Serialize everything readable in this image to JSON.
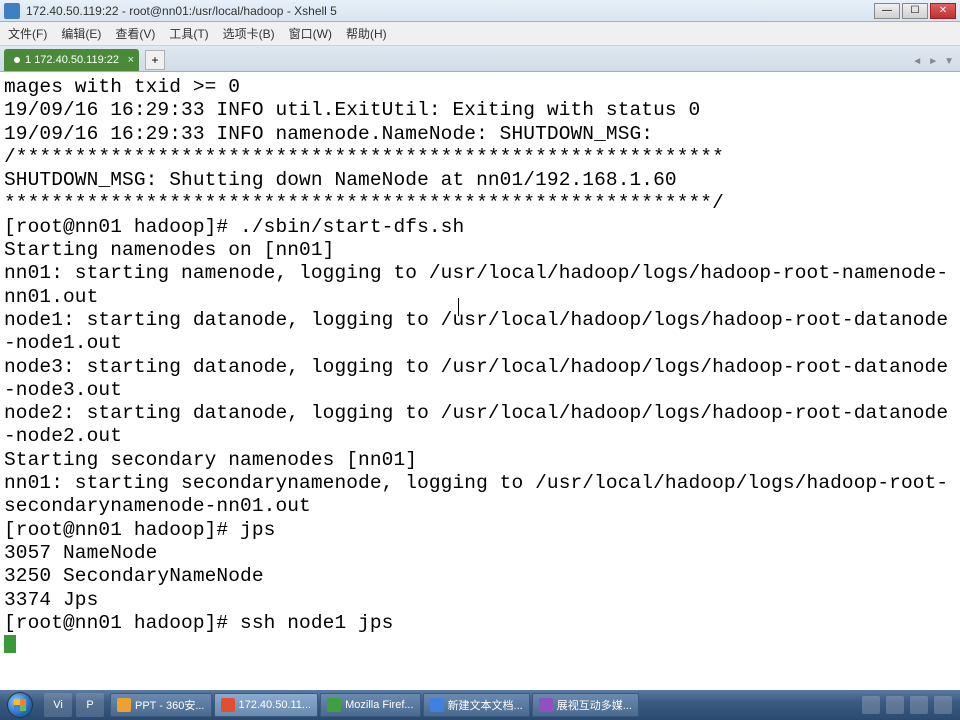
{
  "window": {
    "title": "172.40.50.119:22 - root@nn01:/usr/local/hadoop - Xshell 5"
  },
  "menu": {
    "file": "文件(F)",
    "edit": "编辑(E)",
    "view": "查看(V)",
    "tools": "工具(T)",
    "tabs": "选项卡(B)",
    "window": "窗口(W)",
    "help": "帮助(H)"
  },
  "tab": {
    "index": "1",
    "label": "172.40.50.119:22"
  },
  "terminal": {
    "content": "mages with txid >= 0\n19/09/16 16:29:33 INFO util.ExitUtil: Exiting with status 0\n19/09/16 16:29:33 INFO namenode.NameNode: SHUTDOWN_MSG:\n/************************************************************\nSHUTDOWN_MSG: Shutting down NameNode at nn01/192.168.1.60\n************************************************************/\n[root@nn01 hadoop]# ./sbin/start-dfs.sh\nStarting namenodes on [nn01]\nnn01: starting namenode, logging to /usr/local/hadoop/logs/hadoop-root-namenode-nn01.out\nnode1: starting datanode, logging to /usr/local/hadoop/logs/hadoop-root-datanode-node1.out\nnode3: starting datanode, logging to /usr/local/hadoop/logs/hadoop-root-datanode-node3.out\nnode2: starting datanode, logging to /usr/local/hadoop/logs/hadoop-root-datanode-node2.out\nStarting secondary namenodes [nn01]\nnn01: starting secondarynamenode, logging to /usr/local/hadoop/logs/hadoop-root-secondarynamenode-nn01.out\n[root@nn01 hadoop]# jps\n3057 NameNode\n3250 SecondaryNameNode\n3374 Jps\n[root@nn01 hadoop]# ssh node1 jps\n"
  },
  "taskbar": {
    "apps": [
      {
        "label": "PPT - 360安..."
      },
      {
        "label": "172.40.50.11..."
      },
      {
        "label": "Mozilla Firef..."
      },
      {
        "label": "新建文本文档..."
      },
      {
        "label": "展视互动多媒..."
      }
    ]
  },
  "pinned": {
    "a": "Vi",
    "b": "P"
  }
}
